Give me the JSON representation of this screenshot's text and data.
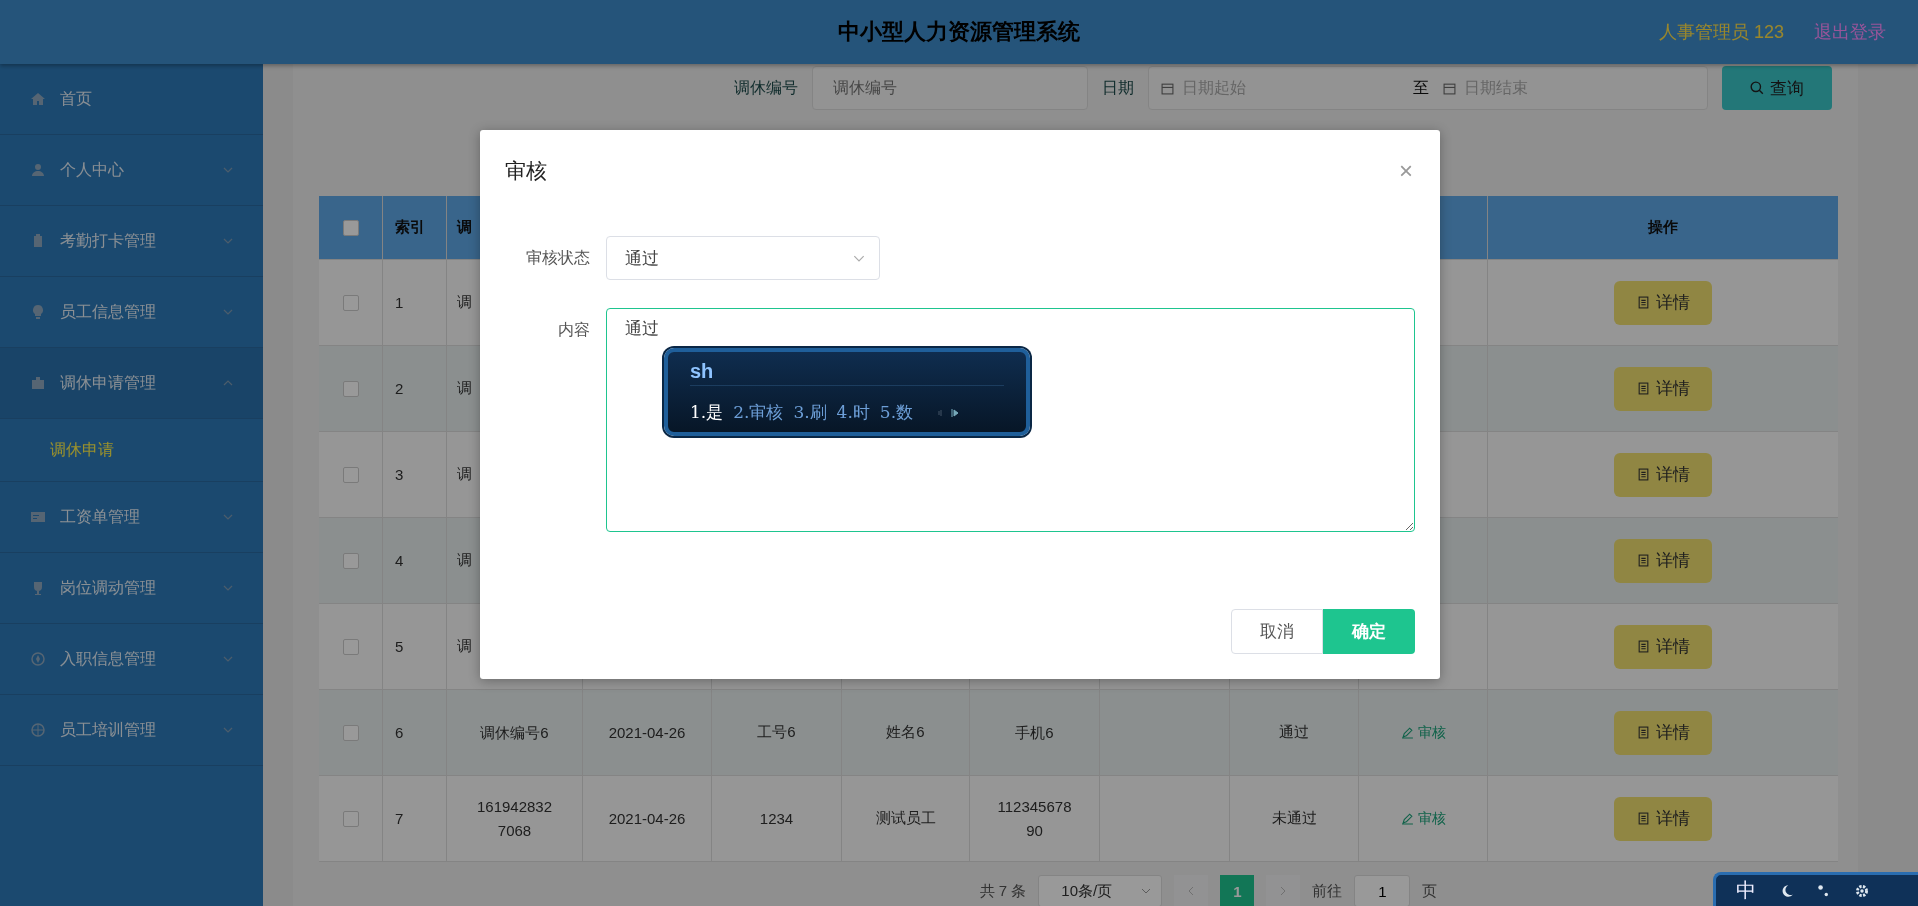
{
  "header": {
    "title": "中小型人力资源管理系统",
    "user": "人事管理员 123",
    "logout": "退出登录"
  },
  "sidebar": {
    "items": [
      {
        "label": "首页"
      },
      {
        "label": "个人中心",
        "expanded": false
      },
      {
        "label": "考勤打卡管理",
        "expanded": false
      },
      {
        "label": "员工信息管理",
        "expanded": false
      },
      {
        "label": "调休申请管理",
        "expanded": true,
        "children": [
          {
            "label": "调休申请",
            "selected": true
          }
        ]
      },
      {
        "label": "工资单管理",
        "expanded": false
      },
      {
        "label": "岗位调动管理",
        "expanded": false
      },
      {
        "label": "入职信息管理",
        "expanded": false
      },
      {
        "label": "员工培训管理",
        "expanded": false
      }
    ]
  },
  "search": {
    "number_label": "调休编号",
    "number_placeholder": "调休编号",
    "date_label": "日期",
    "date_start_placeholder": "日期起始",
    "date_separator": "至",
    "date_end_placeholder": "日期结束",
    "button": "查询"
  },
  "table": {
    "select_all_checked": false,
    "columns": [
      "索引",
      "调"
    ],
    "action_column": "操作",
    "rows": [
      {
        "kind": "covered",
        "checked": false,
        "index": "1",
        "number": "调",
        "detail": "详情"
      },
      {
        "kind": "covered",
        "checked": false,
        "index": "2",
        "number": "调",
        "detail": "详情"
      },
      {
        "kind": "covered",
        "checked": false,
        "index": "3",
        "number": "调",
        "detail": "详情"
      },
      {
        "kind": "covered",
        "checked": false,
        "index": "4",
        "number": "调",
        "detail": "详情"
      },
      {
        "kind": "covered",
        "checked": false,
        "index": "5",
        "number": "调",
        "detail": "详情"
      },
      {
        "kind": "full",
        "checked": false,
        "index": "6",
        "number": "调休编号6",
        "date": "2021-04-26",
        "staff_no": "工号6",
        "name": "姓名6",
        "phone": "手机6",
        "status": "通过",
        "review": "审核",
        "detail": "详情"
      },
      {
        "kind": "full",
        "checked": false,
        "index": "7",
        "number": "1619428327068",
        "date": "2021-04-26",
        "staff_no": "1234",
        "name": "测试员工",
        "phone": "11234567890",
        "status": "未通过",
        "review": "审核",
        "detail": "详情"
      }
    ]
  },
  "pagination": {
    "total": "共 7 条",
    "page_size": "10条/页",
    "pages": [
      {
        "label": "1",
        "selected": true
      }
    ],
    "goto_label": "前往",
    "goto_value": "1",
    "goto_suffix": "页"
  },
  "dialog": {
    "title": "审核",
    "close": "×",
    "status_label": "审核状态",
    "status_value": "通过",
    "content_label": "内容",
    "content_value": "通过",
    "cancel": "取消",
    "confirm": "确定"
  },
  "ime": {
    "composition": "sh",
    "candidates": [
      {
        "label": "1.是",
        "selected": true
      },
      {
        "label": "2.审核",
        "selected": false
      },
      {
        "label": "3.刷",
        "selected": false
      },
      {
        "label": "4.时",
        "selected": false
      },
      {
        "label": "5.数",
        "selected": false
      }
    ]
  },
  "ime_toolbar": {
    "mode": "中"
  }
}
